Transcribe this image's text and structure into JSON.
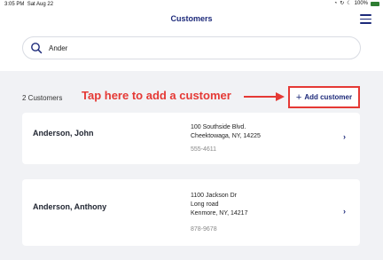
{
  "status_bar": {
    "time": "3:05 PM",
    "date": "Sat Aug 22",
    "battery": "100%"
  },
  "header": {
    "title": "Customers"
  },
  "search": {
    "value": "Ander"
  },
  "list": {
    "count_label": "2 Customers",
    "add_button_label": "Add customer",
    "annotation": "Tap here to add a customer"
  },
  "customers": [
    {
      "name": "Anderson, John",
      "address_lines": [
        "100 Southside Blvd.",
        "Cheektowaga, NY, 14225"
      ],
      "phone": "555-4611"
    },
    {
      "name": "Anderson, Anthony",
      "address_lines": [
        "1100 Jackson Dr",
        "Long road",
        "Kenmore, NY, 14217"
      ],
      "phone": "878-9678"
    }
  ],
  "colors": {
    "brand_navy": "#1d2a7a",
    "annotation_red": "#e53935",
    "background_gray": "#f1f2f5"
  }
}
